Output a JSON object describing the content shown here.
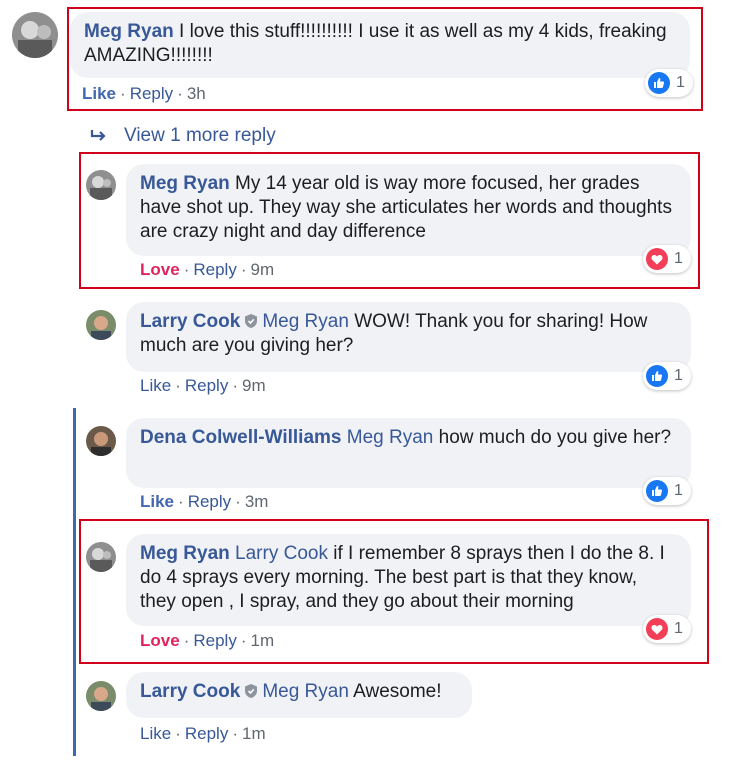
{
  "comments": [
    {
      "author": "Meg Ryan",
      "mention": "",
      "text": "I love this stuff!!!!!!!!!! I use it as well as my 4 kids, freaking AMAZING!!!!!!!!",
      "action_main": "Like",
      "reply": "Reply",
      "time": "3h",
      "reaction_type": "like",
      "reaction_count": "1",
      "avatar": "meg-avatar"
    },
    {
      "author": "Meg Ryan",
      "mention": "",
      "text": "My 14 year old is way more focused, her grades have shot up. They way she articulates her words and thoughts are crazy night and day difference",
      "action_main": "Love",
      "reply": "Reply",
      "time": "9m",
      "reaction_type": "love",
      "reaction_count": "1",
      "avatar": "meg-avatar"
    },
    {
      "author": "Larry Cook",
      "mention": "Meg Ryan",
      "text": "WOW! Thank you for sharing! How much are you giving her?",
      "action_main": "Like",
      "reply": "Reply",
      "time": "9m",
      "reaction_type": "like",
      "reaction_count": "1",
      "avatar": "larry-avatar"
    },
    {
      "author": "Dena Colwell-Williams",
      "mention": "Meg Ryan",
      "text": "how much do you give her?",
      "action_main": "Like",
      "reply": "Reply",
      "time": "3m",
      "reaction_type": "like",
      "reaction_count": "1",
      "avatar": "dena-avatar"
    },
    {
      "author": "Meg Ryan",
      "mention": "Larry Cook",
      "text": "if I remember 8 sprays then I do the 8. I do 4 sprays every morning. The best part is that they know, they open , I spray, and they go about their morning",
      "action_main": "Love",
      "reply": "Reply",
      "time": "1m",
      "reaction_type": "love",
      "reaction_count": "1",
      "avatar": "meg-avatar"
    },
    {
      "author": "Larry Cook",
      "mention": "Meg Ryan",
      "text": "Awesome!",
      "action_main": "Like",
      "reply": "Reply",
      "time": "1m",
      "reaction_type": "",
      "reaction_count": "",
      "avatar": "larry-avatar"
    }
  ],
  "view_more": "View 1 more reply",
  "colors": {
    "link": "#385898",
    "love": "#e0245e",
    "like_icon": "#1877f2",
    "love_icon": "#f33e58",
    "highlight": "#d0021b",
    "thread_line": "#4267b2"
  }
}
